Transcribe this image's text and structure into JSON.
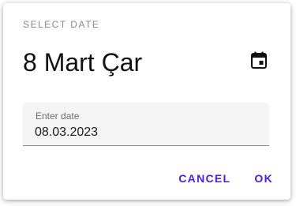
{
  "dialog": {
    "overline": "SELECT DATE",
    "headline": "8 Mart Çar",
    "toggle_icon": "calendar-icon",
    "field": {
      "label": "Enter date",
      "value": "08.03.2023"
    },
    "actions": {
      "cancel_label": "CANCEL",
      "ok_label": "OK"
    },
    "colors": {
      "accent": "#4a1fe0",
      "field_bg": "#f5f5f5",
      "overline": "#8a8a8a"
    }
  }
}
